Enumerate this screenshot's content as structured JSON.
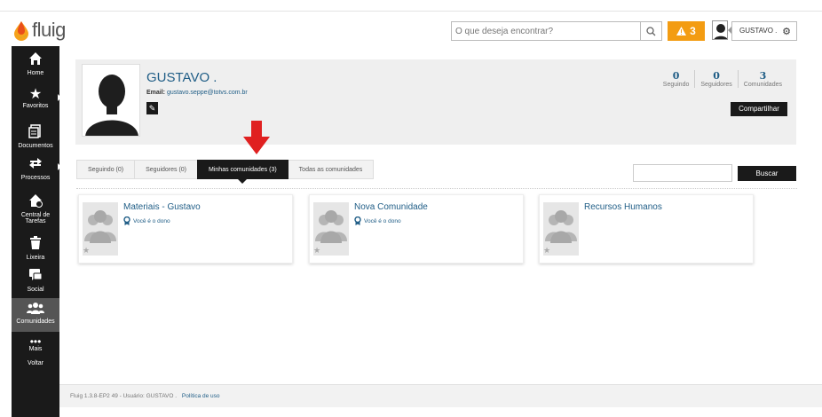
{
  "header": {
    "logo_text": "fluig",
    "search_placeholder": "O que deseja encontrar?",
    "alert_count": "3",
    "user_label": "GUSTAVO ."
  },
  "sidebar": {
    "items": [
      {
        "label": "Home",
        "icon": "home-icon"
      },
      {
        "label": "Favoritos",
        "icon": "star-icon"
      },
      {
        "label": "Documentos",
        "icon": "documents-icon"
      },
      {
        "label": "Processos",
        "icon": "processes-icon"
      },
      {
        "label_line1": "Central de",
        "label_line2": "Tarefas",
        "icon": "tasks-icon"
      },
      {
        "label": "Lixeira",
        "icon": "trash-icon"
      },
      {
        "label": "Social",
        "icon": "chat-icon"
      },
      {
        "label": "Comunidades",
        "icon": "communities-icon"
      },
      {
        "label": "Mais",
        "icon": "more-icon"
      },
      {
        "label": "Voltar",
        "icon": "back-icon"
      }
    ]
  },
  "profile": {
    "name": "GUSTAVO .",
    "email_label": "Email:",
    "email": "gustavo.seppe@totvs.com.br",
    "stats": [
      {
        "value": "0",
        "label": "Seguindo"
      },
      {
        "value": "0",
        "label": "Seguidores"
      },
      {
        "value": "3",
        "label": "Comunidades"
      }
    ],
    "share_label": "Compartilhar"
  },
  "tabs": [
    {
      "label": "Seguindo (0)",
      "active": false
    },
    {
      "label": "Seguidores (0)",
      "active": false
    },
    {
      "label": "Minhas comunidades (3)",
      "active": true
    },
    {
      "label": "Todas as comunidades",
      "active": false
    }
  ],
  "filter": {
    "search_value": "",
    "button_label": "Buscar"
  },
  "communities": [
    {
      "title": "Materiais - Gustavo",
      "owner_text": "Você é o dono"
    },
    {
      "title": "Nova Comunidade",
      "owner_text": "Você é o dono"
    },
    {
      "title": "Recursos Humanos",
      "owner_text": ""
    }
  ],
  "footer": {
    "version_text": "Fluig 1.3.8-EP2 49 - Usuário: GUSTAVO .",
    "policy_link": "Política de uso"
  },
  "colors": {
    "accent_blue": "#1f5d86",
    "alert_orange": "#f39c12",
    "sidebar_bg": "#1a1a1a",
    "annotation_red": "#e02020"
  }
}
